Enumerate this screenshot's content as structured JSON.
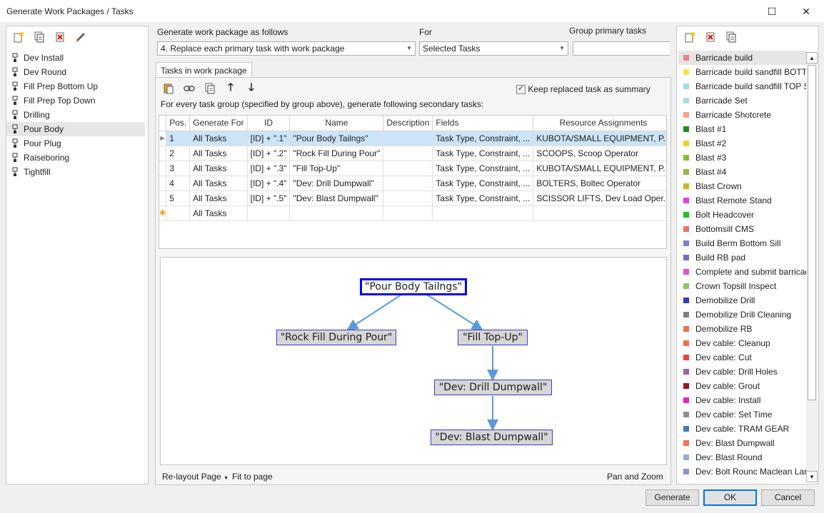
{
  "window": {
    "title": "Generate Work Packages / Tasks",
    "maximize_glyph": "☐",
    "close_glyph": "✕"
  },
  "left_panel": {
    "toolbar_icons": [
      "new-icon",
      "copy-icon",
      "delete-icon",
      "edit-icon"
    ],
    "items": [
      {
        "label": "Dev Install",
        "selected": false
      },
      {
        "label": "Dev Round",
        "selected": false
      },
      {
        "label": "Fill Prep Bottom Up",
        "selected": false
      },
      {
        "label": "Fill Prep Top Down",
        "selected": false
      },
      {
        "label": "Drilling",
        "selected": false
      },
      {
        "label": "Pour Body",
        "selected": true
      },
      {
        "label": "Pour Plug",
        "selected": false
      },
      {
        "label": "Raiseboring",
        "selected": false
      },
      {
        "label": "Tightfill",
        "selected": false
      }
    ]
  },
  "options": {
    "generate_label": "Generate work package as follows",
    "generate_value": "4. Replace each primary task with work package",
    "for_label": "For",
    "for_value": "Selected Tasks",
    "group_label": "Group primary tasks",
    "group_value": ""
  },
  "tab": {
    "label": "Tasks in work package"
  },
  "keep_summary": {
    "label": "Keep replaced task as summary",
    "checked": true
  },
  "instruction": "For every task group (specified by group above), generate following secondary tasks:",
  "grid": {
    "columns": [
      "Pos.",
      "Generate For",
      "ID",
      "Name",
      "Description",
      "Fields",
      "Resource Assignments"
    ],
    "rows": [
      {
        "pos": "1",
        "generate_for": "All Tasks",
        "id": "[ID] + \".1\"",
        "name": "\"Pour Body Tailngs\"",
        "description": "",
        "fields": "Task Type, Constraint, ...",
        "resources": "KUBOTA/SMALL EQUIPMENT, P...",
        "selected": true
      },
      {
        "pos": "2",
        "generate_for": "All Tasks",
        "id": "[ID] + \".2\"",
        "name": "\"Rock Fill During Pour\"",
        "description": "",
        "fields": "Task Type, Constraint, ...",
        "resources": "SCOOPS, Scoop Operator",
        "selected": false
      },
      {
        "pos": "3",
        "generate_for": "All Tasks",
        "id": "[ID] + \".3\"",
        "name": "\"Fill Top-Up\"",
        "description": "",
        "fields": "Task Type, Constraint, ...",
        "resources": "KUBOTA/SMALL EQUIPMENT, P...",
        "selected": false
      },
      {
        "pos": "4",
        "generate_for": "All Tasks",
        "id": "[ID] + \".4\"",
        "name": "\"Dev: Drill Dumpwall\"",
        "description": "",
        "fields": "Task Type, Constraint, ...",
        "resources": "BOLTERS, Boltec Operator",
        "selected": false
      },
      {
        "pos": "5",
        "generate_for": "All Tasks",
        "id": "[ID] + \".5\"",
        "name": "\"Dev: Blast Dumpwall\"",
        "description": "",
        "fields": "Task Type, Constraint, ...",
        "resources": "SCISSOR LIFTS, Dev Load Oper...",
        "selected": false
      }
    ],
    "new_row": {
      "generate_for": "All Tasks"
    },
    "row_indicator": "▶",
    "new_row_indicator": "✱"
  },
  "diagram": {
    "nodes": {
      "n1": "\"Pour Body Tailngs\"",
      "n2": "\"Rock Fill During Pour\"",
      "n3": "\"Fill Top-Up\"",
      "n4": "\"Dev: Drill Dumpwall\"",
      "n5": "\"Dev: Blast Dumpwall\""
    },
    "footer": {
      "relayout": "Re-layout Page",
      "fit": "Fit to page",
      "pan_zoom": "Pan and Zoom"
    }
  },
  "right_panel": {
    "toolbar_icons": [
      "new-icon",
      "delete-icon",
      "copy-icon"
    ],
    "items": [
      {
        "label": "Barricade build",
        "color": "#f08080",
        "selected": true
      },
      {
        "label": "Barricade build sandfill BOTTOM",
        "color": "#f5e050",
        "selected": false
      },
      {
        "label": "Barricade build sandfill TOP SI...",
        "color": "#a8d8ea",
        "selected": false
      },
      {
        "label": "Barricade Set",
        "color": "#add8e6",
        "selected": false
      },
      {
        "label": "Barricade Shotcrete",
        "color": "#f4a582",
        "selected": false
      },
      {
        "label": "Blast #1",
        "color": "#228b22",
        "selected": false
      },
      {
        "label": "Blast #2",
        "color": "#f0d020",
        "selected": false
      },
      {
        "label": "Blast #3",
        "color": "#7cc242",
        "selected": false
      },
      {
        "label": "Blast #4",
        "color": "#8fbc3f",
        "selected": false
      },
      {
        "label": "Blast Crown",
        "color": "#c8b820",
        "selected": false
      },
      {
        "label": "Blast Remote Stand",
        "color": "#e040e0",
        "selected": false
      },
      {
        "label": "Bolt Headcover",
        "color": "#20c020",
        "selected": false
      },
      {
        "label": "Bottomsill CMS",
        "color": "#f07070",
        "selected": false
      },
      {
        "label": "Build Berm Bottom Sill",
        "color": "#8080d0",
        "selected": false
      },
      {
        "label": "Build RB pad",
        "color": "#7070c0",
        "selected": false
      },
      {
        "label": "Complete and submit barricad...",
        "color": "#e050d0",
        "selected": false
      },
      {
        "label": "Crown Topsill Inspect",
        "color": "#90c060",
        "selected": false
      },
      {
        "label": "Demobilize Drill",
        "color": "#3040b0",
        "selected": false
      },
      {
        "label": "Demobilize Drill Cleaning",
        "color": "#808080",
        "selected": false
      },
      {
        "label": "Demobilize RB",
        "color": "#f07050",
        "selected": false
      },
      {
        "label": "Dev cable: Cleanup",
        "color": "#f07050",
        "selected": false
      },
      {
        "label": "Dev cable: Cut",
        "color": "#f04040",
        "selected": false
      },
      {
        "label": "Dev cable: Drill Holes",
        "color": "#a060b0",
        "selected": false
      },
      {
        "label": "Dev cable: Grout",
        "color": "#a01020",
        "selected": false
      },
      {
        "label": "Dev cable: Install",
        "color": "#f020c0",
        "selected": false
      },
      {
        "label": "Dev cable: Set Time",
        "color": "#909090",
        "selected": false
      },
      {
        "label": "Dev cable: TRAM GEAR",
        "color": "#4080b0",
        "selected": false
      },
      {
        "label": "Dev: Blast Dumpwall",
        "color": "#f07050",
        "selected": false
      },
      {
        "label": "Dev: Blast Round",
        "color": "#90b0d0",
        "selected": false
      },
      {
        "label": "Dev: Bolt Rounc Maclean Large",
        "color": "#9090d0",
        "selected": false
      }
    ]
  },
  "buttons": {
    "generate": "Generate",
    "ok": "OK",
    "cancel": "Cancel"
  }
}
